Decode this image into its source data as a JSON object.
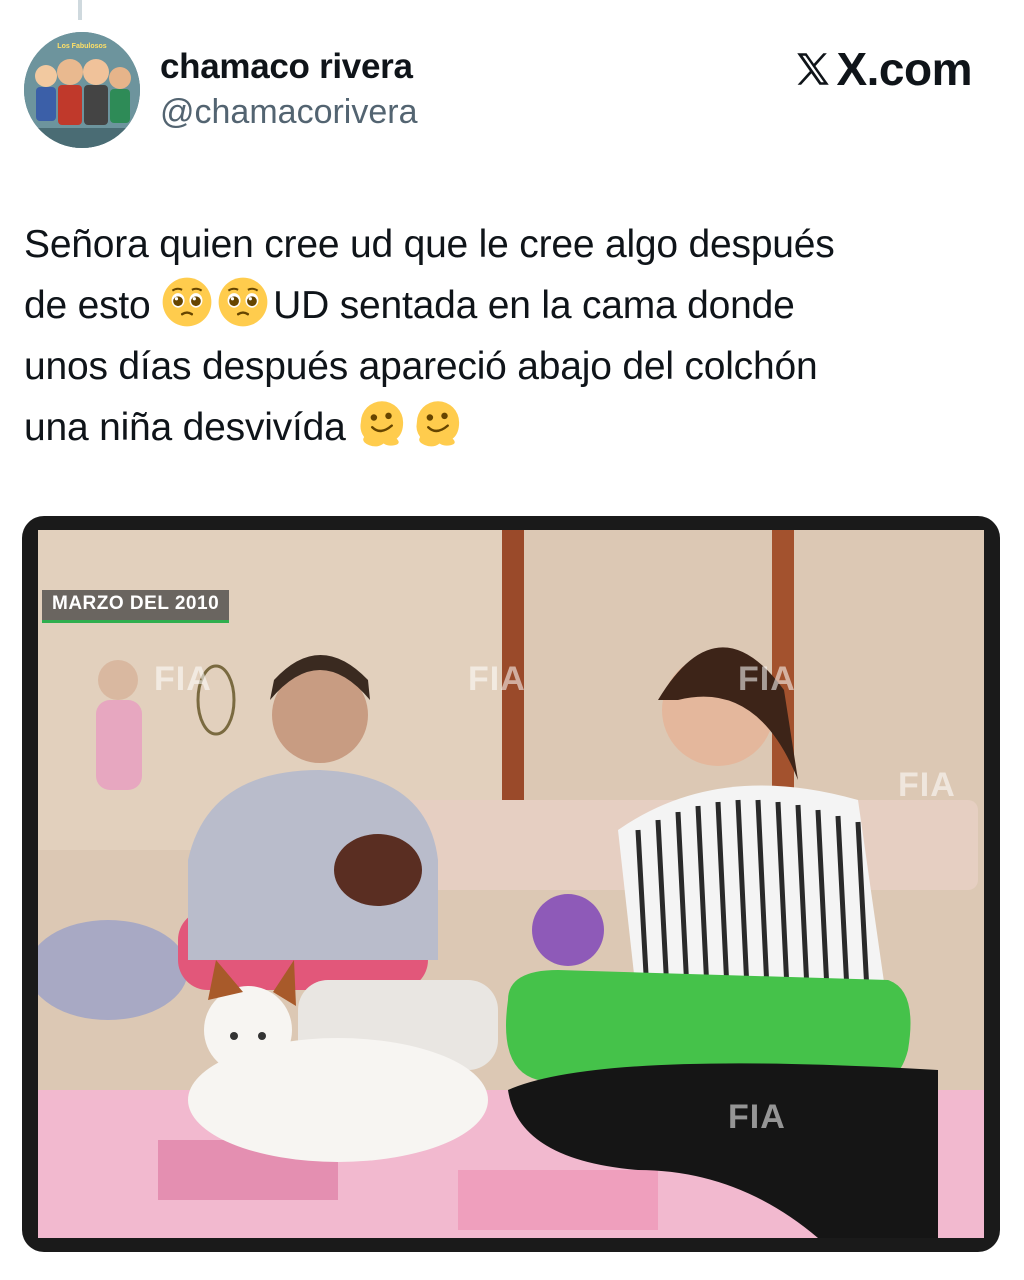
{
  "tweet": {
    "author": {
      "display_name": "chamaco rivera",
      "handle": "@chamacorivera",
      "avatar_caption": "Los Fabulosos"
    },
    "brand": {
      "label": "X.com",
      "icon": "x-logo-icon"
    },
    "text": {
      "line1": "Señora quien cree ud que le cree algo después",
      "line2_before": "de esto ",
      "line2_after": "UD sentada en la cama donde",
      "line3": "unos días después apareció abajo del colchón",
      "line4": "una niña desvivída ",
      "emoji_pleading": "pleading-face-icon",
      "emoji_melting": "melting-face-icon"
    },
    "media": {
      "date_badge": "MARZO DEL 2010",
      "watermark": "FIA"
    }
  }
}
